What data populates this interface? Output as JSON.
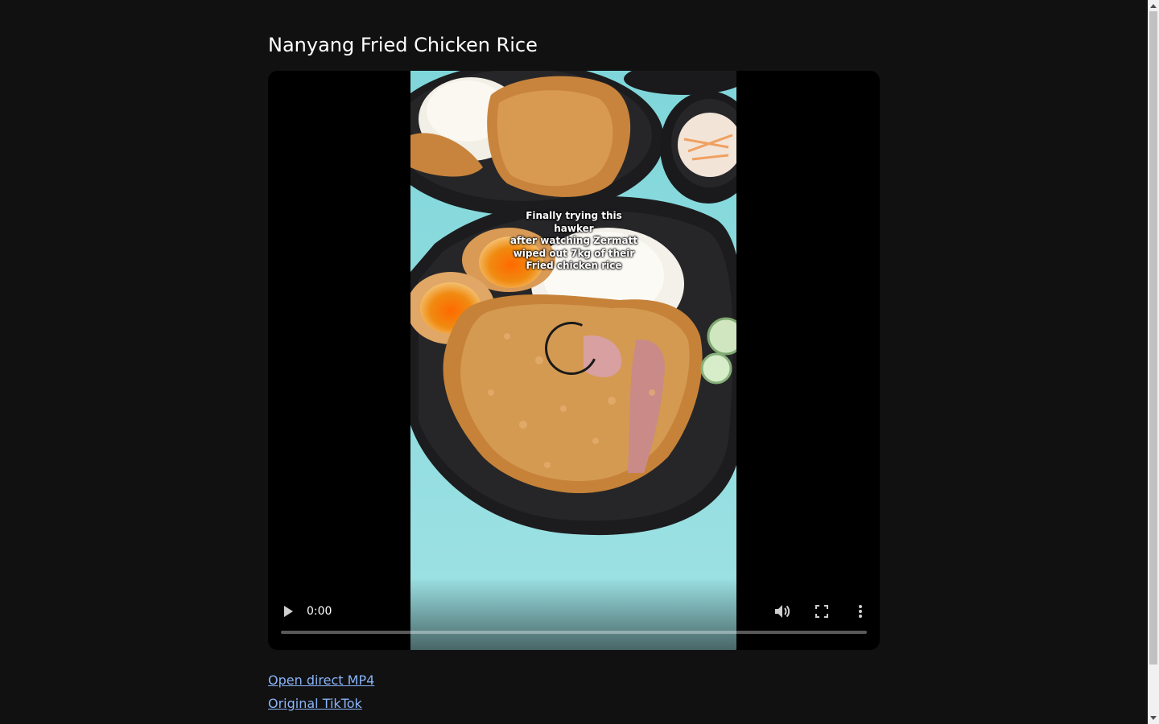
{
  "page": {
    "title": "Nanyang Fried Chicken Rice"
  },
  "video": {
    "caption": "Finally trying this hawker\nafter watching Zermatt\nwiped out 7kg of their\nFried chicken rice",
    "current_time": "0:00",
    "progress_fraction": 0,
    "play_icon": "play-icon",
    "volume_icon": "volume-icon",
    "fullscreen_icon": "fullscreen-icon",
    "more_icon": "more-vert-icon",
    "loading_icon": "loading-spinner-icon"
  },
  "links": [
    {
      "label": "Open direct MP4"
    },
    {
      "label": "Original TikTok"
    }
  ],
  "colors": {
    "page_bg": "#111111",
    "link": "#8ab4f8",
    "player_bg": "#000000"
  }
}
